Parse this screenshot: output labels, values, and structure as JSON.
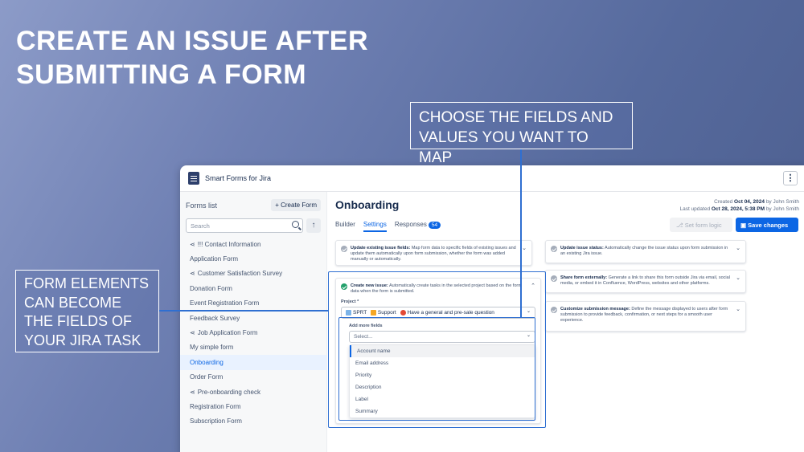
{
  "headline": {
    "line1": "CREATE AN ISSUE AFTER",
    "line2": "SUBMITTING A FORM"
  },
  "callouts": {
    "fields": {
      "line1": "CHOOSE THE FIELDS AND",
      "line2": "VALUES YOU WANT TO MAP"
    },
    "elements": {
      "line1": "FORM ELEMENTS",
      "line2": "CAN BECOME",
      "line3": "THE FIELDS OF",
      "line4": "YOUR JIRA TASK"
    }
  },
  "app": {
    "title": "Smart Forms for Jira",
    "menu_icon": "kebab-icon",
    "sidebar": {
      "title": "Forms list",
      "create_label": "+ Create Form",
      "search_placeholder": "Search",
      "items": [
        {
          "label": "!!! Contact Information",
          "shared": true
        },
        {
          "label": "Application Form",
          "shared": false
        },
        {
          "label": "Customer Satisfaction Survey",
          "shared": true
        },
        {
          "label": "Donation Form",
          "shared": false
        },
        {
          "label": "Event Registration Form",
          "shared": false
        },
        {
          "label": "Feedback Survey",
          "shared": false
        },
        {
          "label": "Job Application Form",
          "shared": true
        },
        {
          "label": "My simple form",
          "shared": false
        },
        {
          "label": "Onboarding",
          "shared": false,
          "active": true
        },
        {
          "label": "Order Form",
          "shared": false
        },
        {
          "label": "Pre-onboarding check",
          "shared": true
        },
        {
          "label": "Registration Form",
          "shared": false
        },
        {
          "label": "Subscription Form",
          "shared": false
        }
      ]
    },
    "main": {
      "title": "Onboarding",
      "created_prefix": "Created",
      "created_date": "Oct 04, 2024",
      "created_by": "by John Smith",
      "updated_prefix": "Last updated",
      "updated_date": "Oct 28, 2024, 5:38 PM",
      "updated_by": "by John Smith",
      "tabs": [
        {
          "label": "Builder"
        },
        {
          "label": "Settings",
          "active": true
        },
        {
          "label": "Responses",
          "badge": "54"
        }
      ],
      "set_logic_label": "Set form logic",
      "save_label": "Save changes",
      "cards": {
        "update_fields": {
          "title": "Update existing issue fields:",
          "text": "Map form data to specific fields of existing issues and update them automatically upon form submission, whether the form was added manually or automatically."
        },
        "create_issue": {
          "title": "Create new issue:",
          "text": "Automatically create tasks in the selected project based on the form data when the form is submitted."
        },
        "update_status": {
          "title": "Update issue status:",
          "text": "Automatically change the issue status upon form submission in an existing Jira issue."
        },
        "share": {
          "title": "Share form externally:",
          "text": "Generate a link to share this form outside Jira via email, social media, or embed it in Confluence, WordPress, websites and other platforms."
        },
        "customize": {
          "title": "Customize submission message:",
          "text": "Define the message displayed to users after form submission to provide feedback, confirmation, or next steps for a smooth user experience."
        }
      },
      "project_label": "Project *",
      "project_value": {
        "key": "SPRT",
        "type": "Support",
        "question": "Have a general and pre-sale question"
      },
      "add_fields_label": "Add more fields",
      "select_placeholder": "Select...",
      "field_options": [
        "Account name",
        "Email address",
        "Priority",
        "Description",
        "Label",
        "Summary"
      ]
    }
  },
  "colors": {
    "accent": "#0c66e4",
    "callout_line": "#2f6fd1",
    "success": "#22a06b"
  }
}
